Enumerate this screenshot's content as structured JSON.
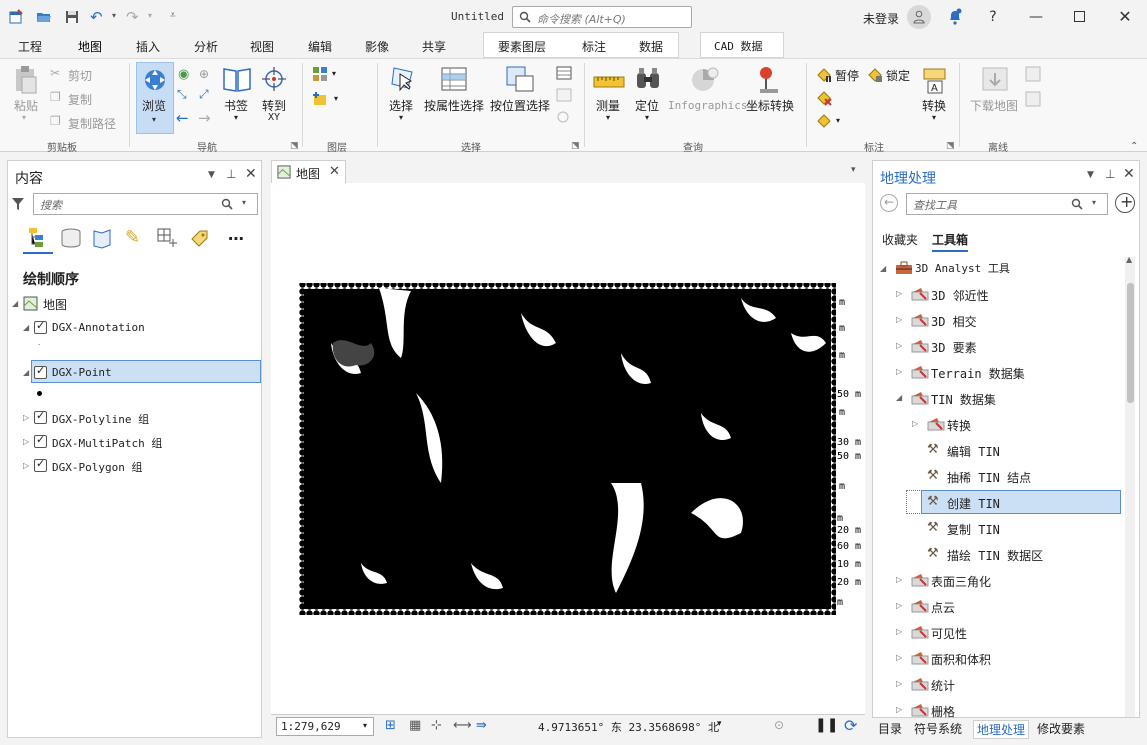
{
  "title_bar": {
    "app_title": "Untitled",
    "search_placeholder": "命令搜索 (Alt+Q)",
    "user": "未登录",
    "help": "?"
  },
  "ribbon_tabs": [
    "工程",
    "地图",
    "插入",
    "分析",
    "视图",
    "编辑",
    "影像",
    "共享"
  ],
  "active_tab": "地图",
  "context_tabs": [
    "要素图层",
    "标注",
    "数据"
  ],
  "cad_tab": "CAD 数据",
  "ribbon": {
    "clipboard": {
      "paste": "粘贴",
      "cut": "剪切",
      "copy": "复制",
      "copy_path": "复制路径",
      "label": "剪贴板"
    },
    "navigate": {
      "explore": "浏览",
      "bookmarks": "书签",
      "goto": "转到",
      "goto2": "XY",
      "label": "导航"
    },
    "layer": {
      "label": "图层"
    },
    "selection": {
      "select": "选择",
      "by_attr": "按属性选择",
      "by_loc": "按位置选择",
      "label": "选择"
    },
    "inquiry": {
      "measure": "测量",
      "locate": "定位",
      "infographics": "Infographics",
      "convert_coord": "坐标转换",
      "label": "查询"
    },
    "labeling": {
      "pause": "暂停",
      "lock": "锁定",
      "convert": "转换",
      "label": "标注"
    },
    "offline": {
      "download": "下载地图",
      "label": "离线"
    }
  },
  "contents_pane": {
    "title": "内容",
    "search_placeholder": "搜索",
    "drawing_order": "绘制顺序",
    "map": "地图",
    "layers": [
      {
        "name": "DGX-Annotation",
        "checked": true
      },
      {
        "name": "DGX-Point",
        "checked": true,
        "selected": true
      },
      {
        "name": "DGX-Polyline 组",
        "checked": true
      },
      {
        "name": "DGX-MultiPatch 组",
        "checked": true
      },
      {
        "name": "DGX-Polygon 组",
        "checked": true
      }
    ]
  },
  "map_view": {
    "tab": "地图",
    "scale": "1:279,629",
    "coords": "4.9713651° 东 23.3568698° 北"
  },
  "geoprocessing": {
    "title": "地理处理",
    "search_placeholder": "查找工具",
    "tabs": [
      "收藏夹",
      "工具箱"
    ],
    "active_tab": "工具箱",
    "root": "3D Analyst 工具",
    "toolsets": [
      {
        "label": "3D 邻近性",
        "level": 1,
        "expanded": false
      },
      {
        "label": "3D 相交",
        "level": 1,
        "expanded": false
      },
      {
        "label": "3D 要素",
        "level": 1,
        "expanded": false
      },
      {
        "label": "Terrain 数据集",
        "level": 1,
        "expanded": false
      },
      {
        "label": "TIN 数据集",
        "level": 1,
        "expanded": true
      },
      {
        "label": "转换",
        "level": 2,
        "expanded": false
      },
      {
        "label": "编辑 TIN",
        "level": 2,
        "tool": true
      },
      {
        "label": "抽稀 TIN 结点",
        "level": 2,
        "tool": true
      },
      {
        "label": "创建 TIN",
        "level": 2,
        "tool": true,
        "selected": true
      },
      {
        "label": "复制 TIN",
        "level": 2,
        "tool": true
      },
      {
        "label": "描绘 TIN 数据区",
        "level": 2,
        "tool": true
      },
      {
        "label": "表面三角化",
        "level": 1,
        "expanded": false
      },
      {
        "label": "点云",
        "level": 1,
        "expanded": false
      },
      {
        "label": "可见性",
        "level": 1,
        "expanded": false
      },
      {
        "label": "面积和体积",
        "level": 1,
        "expanded": false
      },
      {
        "label": "统计",
        "level": 1,
        "expanded": false
      },
      {
        "label": "栅格",
        "level": 1,
        "expanded": false
      }
    ],
    "bottom_tabs": [
      "目录",
      "符号系统",
      "地理处理",
      "修改要素"
    ],
    "active_bottom_tab": "地理处理"
  },
  "colors": {
    "accent": "#2b6cc4",
    "selection": "#cce0f5",
    "selection_border": "#5a8fcc"
  }
}
